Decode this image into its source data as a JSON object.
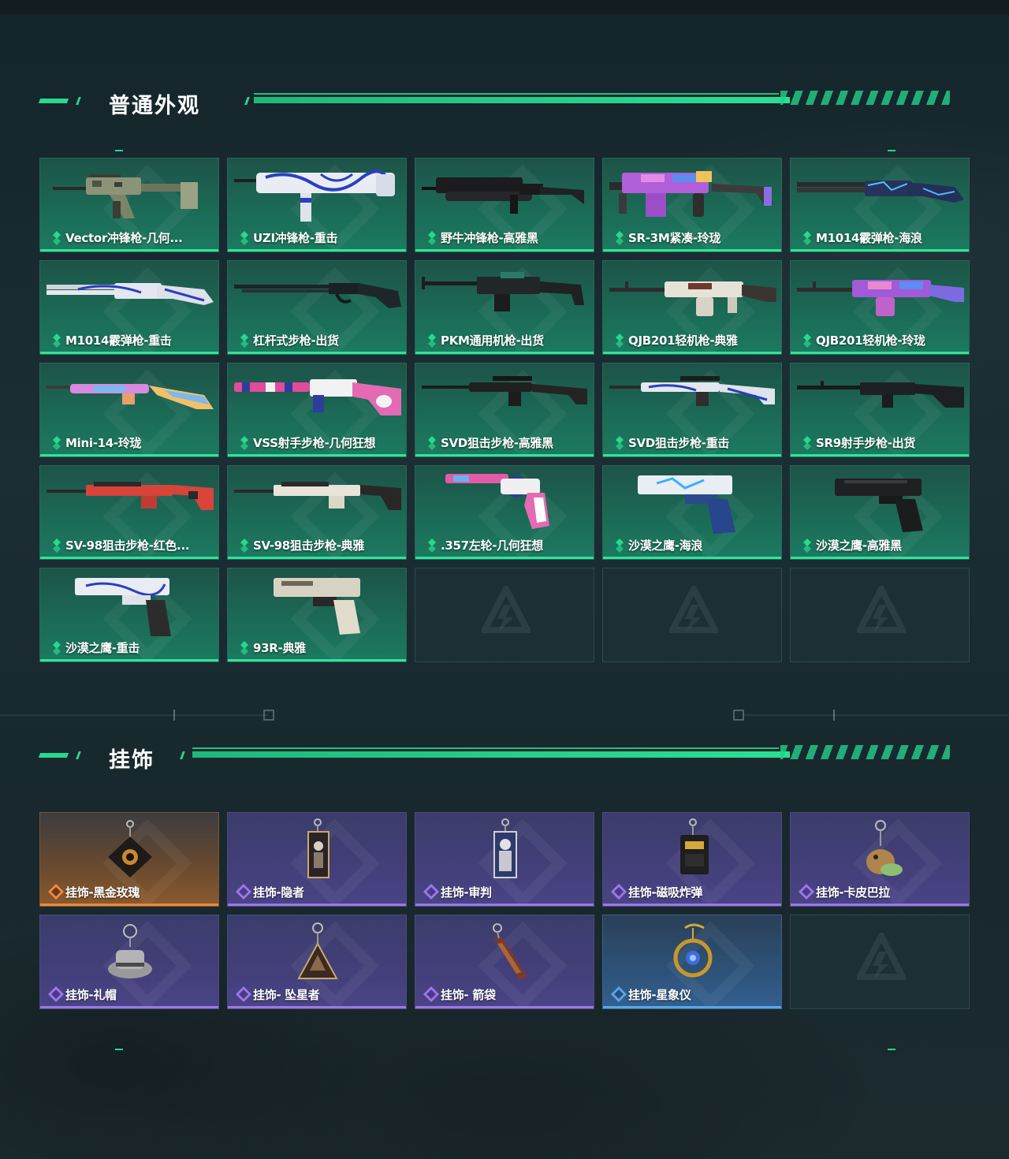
{
  "sections": {
    "skins": {
      "title": "普通外观",
      "items": [
        {
          "label": "Vector冲锋枪-几何..."
        },
        {
          "label": "UZI冲锋枪-重击"
        },
        {
          "label": "野牛冲锋枪-高雅黑"
        },
        {
          "label": "SR-3M紧凑-玲珑"
        },
        {
          "label": "M1014霰弹枪-海浪"
        },
        {
          "label": "M1014霰弹枪-重击"
        },
        {
          "label": "杠杆式步枪-出货"
        },
        {
          "label": "PKM通用机枪-出货"
        },
        {
          "label": "QJB201轻机枪-典雅"
        },
        {
          "label": "QJB201轻机枪-玲珑"
        },
        {
          "label": "Mini-14-玲珑"
        },
        {
          "label": "VSS射手步枪-几何狂想"
        },
        {
          "label": "SVD狙击步枪-高雅黑"
        },
        {
          "label": "SVD狙击步枪-重击"
        },
        {
          "label": "SR9射手步枪-出货"
        },
        {
          "label": "SV-98狙击步枪-红色..."
        },
        {
          "label": "SV-98狙击步枪-典雅"
        },
        {
          "label": ".357左轮-几何狂想"
        },
        {
          "label": "沙漠之鹰-海浪"
        },
        {
          "label": "沙漠之鹰-高雅黑"
        },
        {
          "label": "沙漠之鹰-重击"
        },
        {
          "label": "93R-典雅"
        }
      ]
    },
    "charms": {
      "title": "挂饰",
      "items": [
        {
          "label": "挂饰-黑金玫瑰",
          "rarity_color": "#ef8a3a"
        },
        {
          "label": "挂饰-隐者",
          "rarity_color": "#9b78e8"
        },
        {
          "label": "挂饰-审判",
          "rarity_color": "#9b78e8"
        },
        {
          "label": "挂饰-磁吸炸弹",
          "rarity_color": "#9b78e8"
        },
        {
          "label": "挂饰-卡皮巴拉",
          "rarity_color": "#9b78e8"
        },
        {
          "label": "挂饰-礼帽",
          "rarity_color": "#9b78e8"
        },
        {
          "label": "挂饰- 坠星者",
          "rarity_color": "#9b78e8"
        },
        {
          "label": "挂饰- 箭袋",
          "rarity_color": "#9b78e8"
        },
        {
          "label": "挂饰-星象仪",
          "rarity_color": "#5aa6e8"
        }
      ]
    }
  },
  "colors": {
    "accent": "#27d88f",
    "skin_card_bottom": "#2ee59a"
  }
}
